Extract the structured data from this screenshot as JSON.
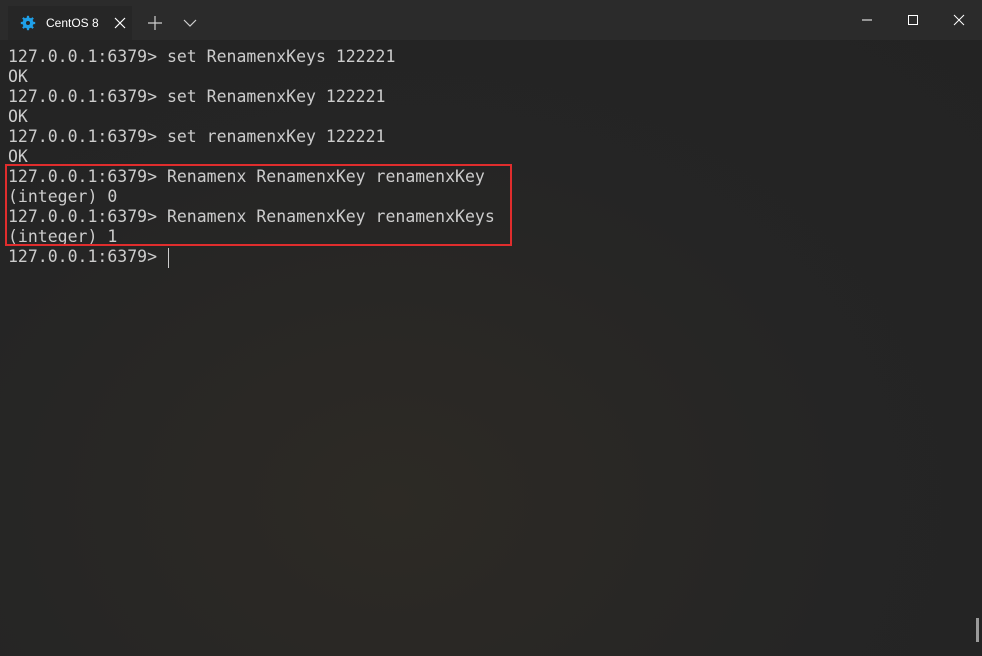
{
  "tab": {
    "title": "CentOS 8",
    "icon": "centos-gear-icon"
  },
  "terminal": {
    "lines": [
      "127.0.0.1:6379> set RenamenxKeys 122221",
      "OK",
      "127.0.0.1:6379> set RenamenxKey 122221",
      "OK",
      "127.0.0.1:6379> set renamenxKey 122221",
      "OK",
      "127.0.0.1:6379> Renamenx RenamenxKey renamenxKey",
      "(integer) 0",
      "127.0.0.1:6379> Renamenx RenamenxKey renamenxKeys",
      "(integer) 1",
      "127.0.0.1:6379> "
    ]
  },
  "colors": {
    "accent": "#1fa0e8",
    "highlight": "#e02d2d",
    "text": "#cccccc"
  }
}
